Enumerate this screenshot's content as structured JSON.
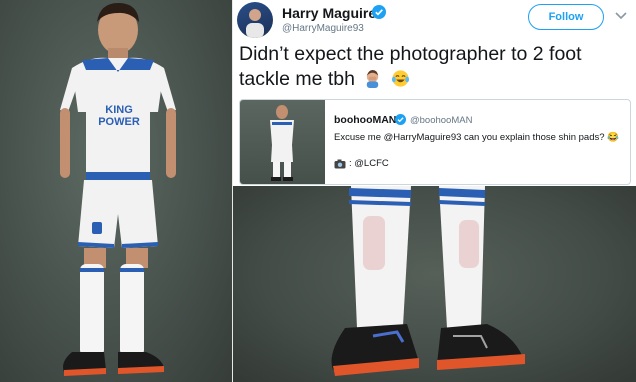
{
  "tweet": {
    "display_name": "Harry Maguire",
    "handle": "@HarryMaguire93",
    "follow_label": "Follow",
    "text": "Didn’t expect the photographer to 2 foot tackle me tbh",
    "icons": [
      "verified-icon",
      "man-facepalming-emoji",
      "tears-of-joy-emoji",
      "chevron-down-icon"
    ]
  },
  "quote": {
    "display_name": "boohooMAN",
    "handle": "@boohooMAN",
    "text": "Excuse me @HarryMaguire93 can you explain those shin pads? 😂",
    "credit": ": @LCFC",
    "credit_icon": "camera-icon"
  },
  "photo": {
    "shirt_text": "KING POWER",
    "colors": {
      "kit_white": "#f4f4f4",
      "kit_blue": "#2b5fb4",
      "background": "#4a544f",
      "boot_black": "#1a1a1a",
      "boot_orange": "#e0562a"
    }
  },
  "colors": {
    "accent": "#1da1f2",
    "text": "#14171a",
    "muted": "#657786",
    "border": "#ccd6dd"
  }
}
